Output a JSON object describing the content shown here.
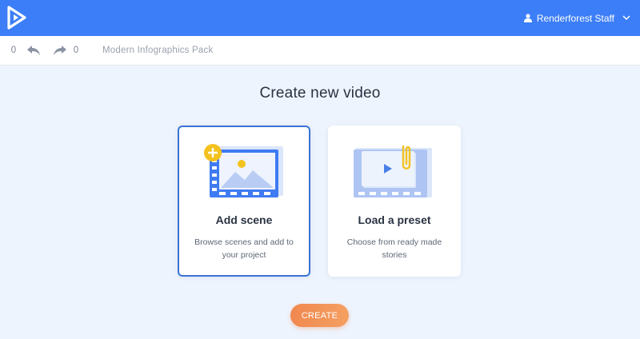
{
  "header": {
    "user_name": "Renderforest Staff"
  },
  "toolbar": {
    "undo_count": "0",
    "redo_count": "0",
    "project_name": "Modern Infographics Pack"
  },
  "main": {
    "title": "Create new video",
    "cards": [
      {
        "title": "Add scene",
        "description": "Browse scenes and add to your project",
        "icon": "film-add-scene-icon",
        "selected": true
      },
      {
        "title": "Load a preset",
        "description": "Choose from ready made stories",
        "icon": "film-preset-icon",
        "selected": false
      }
    ],
    "create_label": "CREATE"
  },
  "colors": {
    "header_bg": "#3c7ef7",
    "accent_orange": "#f0884f",
    "selected_border": "#3a74d6",
    "page_bg": "#eef4fd"
  }
}
